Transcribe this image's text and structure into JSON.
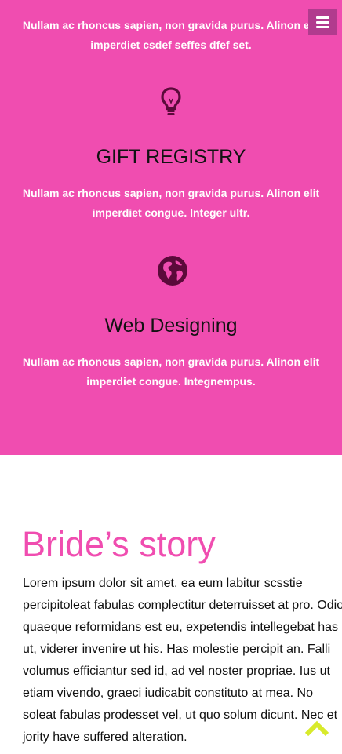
{
  "features": {
    "item1": {
      "description": "Nullam ac rhoncus sapien, non gravida purus. Alinon elit imperdiet csdef seffes dfef set."
    },
    "item2": {
      "icon": "lightbulb-icon",
      "title": "GIFT REGISTRY",
      "description": "Nullam ac rhoncus sapien, non gravida purus. Alinon elit imperdiet congue. Integer ultr."
    },
    "item3": {
      "icon": "globe-icon",
      "title": "Web Designing",
      "description": "Nullam ac rhoncus sapien, non gravida purus. Alinon elit imperdiet congue. Integnempus."
    }
  },
  "menu": {
    "icon": "hamburger-menu-icon"
  },
  "story": {
    "heading": "Bride’s story",
    "text": "Lorem ipsum dolor sit amet, ea eum labitur scsstie percipitoleat fabulas complectitur deterruisset at pro. Odio quaeque reformidans est eu, expetendis intellegebat has ut, viderer invenire ut his. Has molestie percipit an. Falli volumus efficiantur sed id, ad vel noster propriae. Ius ut etiam vivendo, graeci iudicabit constituto at mea. No soleat fabulas prodesset vel, ut quo solum dicunt. Nec et jority have suffered alteration."
  },
  "scroll_top": {
    "icon": "chevron-up-icon"
  },
  "colors": {
    "section_background": "#f04db0",
    "heading_accent": "#f04db0",
    "icon": "#5b0a3a",
    "menu_button": "#b13b8e",
    "scroll_top": "#d8ea2b"
  }
}
